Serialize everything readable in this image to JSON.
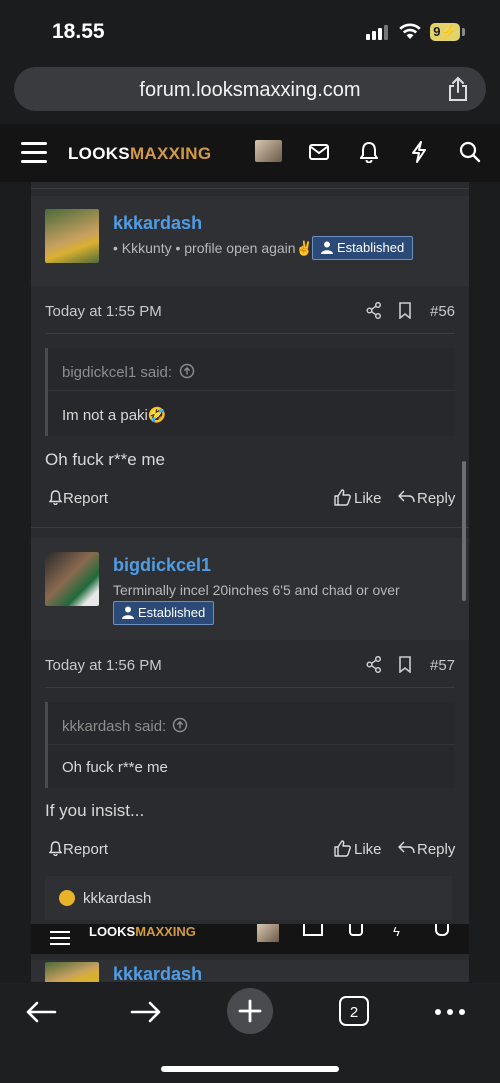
{
  "status": {
    "time": "18.55",
    "battery": "9"
  },
  "browser": {
    "url": "forum.looksmaxxing.com",
    "tab_count": "2"
  },
  "site": {
    "logo_part1": "LOOKS",
    "logo_part2": "MAXXING"
  },
  "posts": [
    {
      "username": "kkkardash",
      "user_title": "• Kkkunty • profile open again✌️",
      "badge": "Established",
      "date": "Today at 1:55 PM",
      "number": "#56",
      "quote_author": "bigdickcel1 said:",
      "quote_text": "Im not a paki🤣",
      "message": "Oh fuck r**e me",
      "report": "Report",
      "like": "Like",
      "reply": "Reply"
    },
    {
      "username": "bigdickcel1",
      "user_title": "Terminally incel 20inches 6'5 and chad or over",
      "badge": "Established",
      "date": "Today at 1:56 PM",
      "number": "#57",
      "quote_author": "kkkardash said:",
      "quote_text": "Oh fuck r**e me",
      "message": "If you insist...",
      "report": "Report",
      "like": "Like",
      "reply": "Reply",
      "reaction_user": "kkkardash"
    }
  ],
  "next_post": {
    "username": "kkkardash"
  },
  "colors": {
    "accent": "#4f9de6",
    "logo_gold": "#d39a45",
    "badge_bg": "#2c4a78"
  }
}
